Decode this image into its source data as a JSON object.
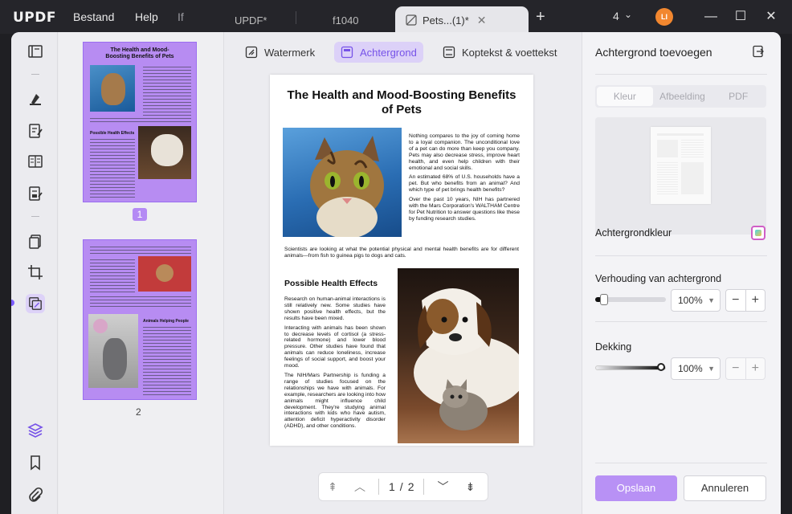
{
  "app": {
    "logo": "UPDF"
  },
  "menu": {
    "file": "Bestand",
    "help": "Help",
    "if": "If"
  },
  "tabs": [
    {
      "label": "UPDF*"
    },
    {
      "label": "f1040"
    },
    {
      "label": "Pets...(1)*",
      "active": true
    }
  ],
  "window": {
    "page_count": "4",
    "avatar": "LI"
  },
  "toolbar": {
    "watermark": "Watermerk",
    "background": "Achtergrond",
    "header_footer": "Koptekst & voettekst"
  },
  "document": {
    "title": "The Health and Mood-Boosting Benefits of Pets",
    "intro_p1": "Nothing compares to the joy of coming home to a loyal companion. The unconditional love of a pet can do more than keep you company. Pets may also decrease stress, improve heart health, and even help children with their emotional and social skills.",
    "intro_p2": "An estimated 68% of U.S. households have a pet. But who benefits from an animal? And which type of pet brings health benefits?",
    "intro_p3": "Over the past 10 years, NIH has partnered with the Mars Corporation's WALTHAM Centre for Pet Nutrition to answer questions like these by funding research studies.",
    "summary": "Scientists are looking at what the potential physical and mental health benefits are for different animals—from fish to guinea pigs to dogs and cats.",
    "section_heading": "Possible Health Effects",
    "section_p1": "Research on human-animal interactions is still relatively new. Some studies have shown positive health effects, but the results have been mixed.",
    "section_p2": "Interacting with animals has been shown to decrease levels of cortisol (a stress-related hormone) and lower blood pressure. Other studies have found that animals can reduce loneliness, increase feelings of social support, and boost your mood.",
    "section_p3": "The NIH/Mars Partnership is funding a range of studies focused on the relationships we have with animals. For example, researchers are looking into how animals might influence child development. They're studying animal interactions with kids who have autism, attention deficit hyperactivity disorder (ADHD), and other conditions."
  },
  "thumbnails": [
    {
      "number": "1"
    },
    {
      "number": "2"
    }
  ],
  "thumb2_heading": "Animals Helping People",
  "pager": {
    "current": "1",
    "separator": "/",
    "total": "2"
  },
  "panel": {
    "title": "Achtergrond toevoegen",
    "seg_color": "Kleur",
    "seg_image": "Afbeelding",
    "seg_pdf": "PDF",
    "bg_color_label": "Achtergrondkleur",
    "ratio_label": "Verhouding van achtergrond",
    "ratio_value": "100%",
    "ratio_slider_fraction": 0.09,
    "opacity_label": "Dekking",
    "opacity_value": "100%",
    "opacity_slider_fraction": 1.0,
    "save": "Opslaan",
    "cancel": "Annuleren"
  },
  "colors": {
    "accent": "#7652e8",
    "page_bg": "#b78cf2",
    "avatar": "#f2872f"
  }
}
